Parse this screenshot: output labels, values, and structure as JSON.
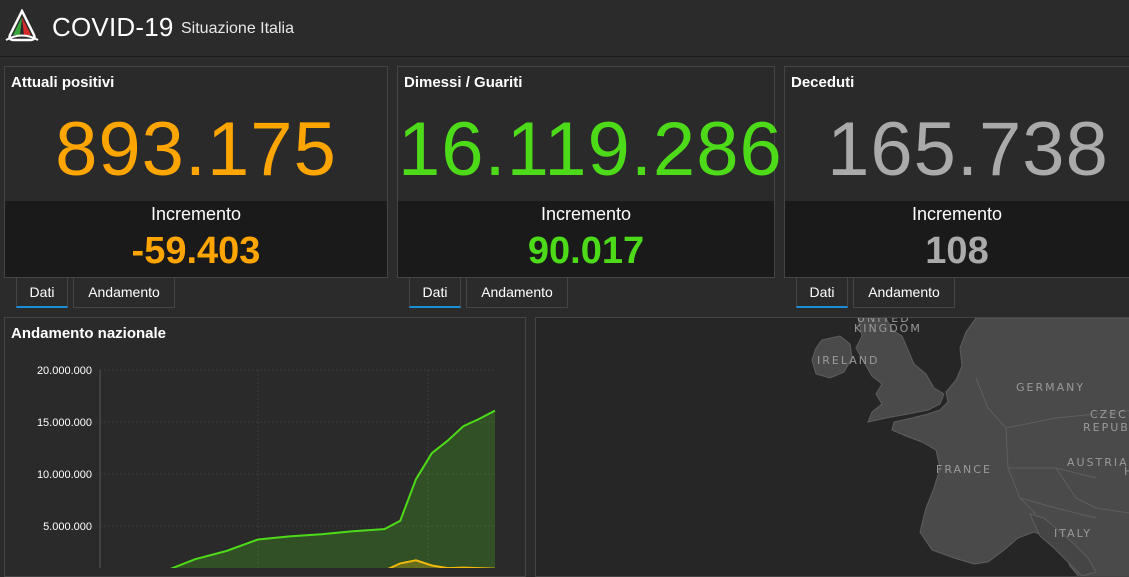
{
  "header": {
    "title": "COVID-19",
    "subtitle": "Situazione Italia"
  },
  "panels": [
    {
      "title": "Attuali positivi",
      "value": "893.175",
      "increment_label": "Incremento",
      "increment": "-59.403",
      "color": "#ffa500"
    },
    {
      "title": "Dimessi / Guariti",
      "value": "16.119.286",
      "increment_label": "Incremento",
      "increment": "90.017",
      "color": "#4ddb19"
    },
    {
      "title": "Deceduti",
      "value": "165.738",
      "increment_label": "Incremento",
      "increment": "108",
      "color": "#aaaaaa"
    }
  ],
  "tabs": [
    {
      "dati": "Dati",
      "andamento": "Andamento"
    },
    {
      "dati": "Dati",
      "andamento": "Andamento"
    },
    {
      "dati": "Dati",
      "andamento": "Andamento"
    }
  ],
  "chart": {
    "title": "Andamento nazionale"
  },
  "chart_data": {
    "type": "area",
    "title": "Andamento nazionale",
    "xlabel": "",
    "ylabel": "",
    "ylim": [
      0,
      20000000
    ],
    "yticks": [
      "20.000.000",
      "15.000.000",
      "10.000.000",
      "5.000.000"
    ],
    "ytick_values": [
      20000000,
      15000000,
      10000000,
      5000000
    ],
    "grid": true,
    "series": [
      {
        "color": "#4ddb19",
        "x": [
          0,
          0.08,
          0.16,
          0.24,
          0.32,
          0.4,
          0.48,
          0.56,
          0.64,
          0.72,
          0.76,
          0.8,
          0.84,
          0.88,
          0.92,
          0.96,
          1.0
        ],
        "values": [
          0,
          80000,
          600000,
          1800000,
          2600000,
          3700000,
          4000000,
          4200000,
          4500000,
          4700000,
          5500000,
          9500000,
          12000000,
          13200000,
          14600000,
          15300000,
          16100000
        ]
      },
      {
        "color": "#f0b90b",
        "x": [
          0,
          0.08,
          0.16,
          0.24,
          0.32,
          0.4,
          0.48,
          0.56,
          0.64,
          0.72,
          0.76,
          0.8,
          0.84,
          0.88,
          0.92,
          0.96,
          1.0
        ],
        "values": [
          0,
          90000,
          150000,
          70000,
          50000,
          40000,
          30000,
          90000,
          300000,
          700000,
          1400000,
          1700000,
          1200000,
          950000,
          1000000,
          950000,
          900000
        ]
      }
    ]
  },
  "map": {
    "labels": {
      "united_kingdom_1": "UNITED",
      "united_kingdom_2": "KINGDOM",
      "ireland": "IRELAND",
      "germany": "GERMANY",
      "czech_1": "CZECH",
      "czech_2": "REPUBLIC",
      "france": "FRANCE",
      "austria": "AUSTRIA",
      "italy": "ITALY",
      "h": "H"
    },
    "colors": {
      "land": "#4a4a4a",
      "sea": "#262626",
      "border": "#5e5e5e"
    }
  }
}
